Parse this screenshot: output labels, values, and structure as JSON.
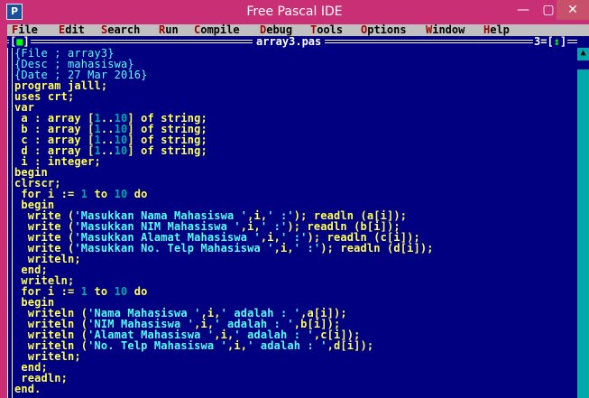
{
  "window": {
    "title": "Free Pascal IDE",
    "min": "—",
    "max": "▢",
    "close": "✕"
  },
  "menu": [
    {
      "hot": "F",
      "rest": "ile"
    },
    {
      "hot": "E",
      "rest": "dit"
    },
    {
      "hot": "S",
      "rest": "earch"
    },
    {
      "hot": "R",
      "rest": "un"
    },
    {
      "hot": "C",
      "rest": "ompile"
    },
    {
      "hot": "D",
      "rest": "ebug"
    },
    {
      "hot": "T",
      "rest": "ools"
    },
    {
      "hot": "O",
      "rest": "ptions"
    },
    {
      "hot": "W",
      "rest": "indow"
    },
    {
      "hot": "H",
      "rest": "elp"
    }
  ],
  "editor_window": {
    "close_box_left": "[",
    "close_box_mark": "■",
    "close_box_right": "]",
    "filename": "array3.pas",
    "number": "3",
    "zoom_left": "=[",
    "zoom_mark": "↕",
    "zoom_right": "]"
  },
  "code": [
    [
      [
        "cmt",
        "{File ; array3}"
      ]
    ],
    [
      [
        "cmt",
        "{Desc ; mahasiswa}"
      ]
    ],
    [
      [
        "cmt",
        "{Date ; 27 Mar 2016}"
      ]
    ],
    [
      [
        "t",
        "program jalll;"
      ]
    ],
    [
      [
        "t",
        "uses crt;"
      ]
    ],
    [
      [
        "t",
        "var"
      ]
    ],
    [
      [
        "t",
        " a : array ["
      ],
      [
        "num",
        "1"
      ],
      [
        "t",
        ".."
      ],
      [
        "num",
        "10"
      ],
      [
        "t",
        "] of string;"
      ]
    ],
    [
      [
        "t",
        " b : array ["
      ],
      [
        "num",
        "1"
      ],
      [
        "t",
        ".."
      ],
      [
        "num",
        "10"
      ],
      [
        "t",
        "] of string;"
      ]
    ],
    [
      [
        "t",
        " c : array ["
      ],
      [
        "num",
        "1"
      ],
      [
        "t",
        ".."
      ],
      [
        "num",
        "10"
      ],
      [
        "t",
        "] of string;"
      ]
    ],
    [
      [
        "t",
        " d : array ["
      ],
      [
        "num",
        "1"
      ],
      [
        "t",
        ".."
      ],
      [
        "num",
        "10"
      ],
      [
        "t",
        "] of string;"
      ]
    ],
    [
      [
        "t",
        " i : integer;"
      ]
    ],
    [
      [
        "t",
        "begin"
      ]
    ],
    [
      [
        "t",
        "clrscr;"
      ]
    ],
    [
      [
        "t",
        " for i := "
      ],
      [
        "num",
        "1"
      ],
      [
        "t",
        " to "
      ],
      [
        "num",
        "10"
      ],
      [
        "t",
        " do"
      ]
    ],
    [
      [
        "t",
        " begin"
      ]
    ],
    [
      [
        "t",
        "  write ("
      ],
      [
        "str",
        "'Masukkan Nama Mahasiswa '"
      ],
      [
        "t",
        ",i,"
      ],
      [
        "str",
        "' :'"
      ],
      [
        "t",
        "); readln (a[i]);"
      ]
    ],
    [
      [
        "t",
        "  write ("
      ],
      [
        "str",
        "'Masukkan NIM Mahasiswa '"
      ],
      [
        "t",
        ",i,"
      ],
      [
        "str",
        "' :'"
      ],
      [
        "t",
        "); readln (b[i]);"
      ]
    ],
    [
      [
        "t",
        "  write ("
      ],
      [
        "str",
        "'Masukkan Alamat Mahasiswa '"
      ],
      [
        "t",
        ",i,"
      ],
      [
        "str",
        "' :'"
      ],
      [
        "t",
        "); readln (c[i]);"
      ]
    ],
    [
      [
        "t",
        "  write ("
      ],
      [
        "str",
        "'Masukkan No. Telp Mahasiswa '"
      ],
      [
        "t",
        ",i,"
      ],
      [
        "str",
        "' :'"
      ],
      [
        "t",
        "); readln (d[i]);"
      ]
    ],
    [
      [
        "t",
        "  writeln;"
      ]
    ],
    [
      [
        "t",
        " end;"
      ]
    ],
    [
      [
        "t",
        " writeln;"
      ]
    ],
    [
      [
        "t",
        " for i := "
      ],
      [
        "num",
        "1"
      ],
      [
        "t",
        " to "
      ],
      [
        "num",
        "10"
      ],
      [
        "t",
        " do"
      ]
    ],
    [
      [
        "t",
        " begin"
      ]
    ],
    [
      [
        "t",
        "  writeln ("
      ],
      [
        "str",
        "'Nama Mahasiswa '"
      ],
      [
        "t",
        ",i,"
      ],
      [
        "str",
        "' adalah : '"
      ],
      [
        "t",
        ",a[i]);"
      ]
    ],
    [
      [
        "t",
        "  writeln ("
      ],
      [
        "str",
        "'NIM Mahasiswa '"
      ],
      [
        "t",
        ",i,"
      ],
      [
        "str",
        "' adalah : '"
      ],
      [
        "t",
        ",b[i]);"
      ]
    ],
    [
      [
        "t",
        "  writeln ("
      ],
      [
        "str",
        "'Alamat Mahasiswa '"
      ],
      [
        "t",
        ",i,"
      ],
      [
        "str",
        "' adalah : '"
      ],
      [
        "t",
        ",c[i]);"
      ]
    ],
    [
      [
        "t",
        "  writeln ("
      ],
      [
        "str",
        "'No. Telp Mahasiswa '"
      ],
      [
        "t",
        ",i,"
      ],
      [
        "str",
        "' adalah : '"
      ],
      [
        "t",
        ",d[i]);"
      ]
    ],
    [
      [
        "t",
        "  writeln;"
      ]
    ],
    [
      [
        "t",
        " end;"
      ]
    ],
    [
      [
        "t",
        " readln;"
      ]
    ],
    [
      [
        "t",
        "end."
      ]
    ]
  ],
  "scrollbar": {
    "up_arrow": "▲"
  },
  "colors": {
    "titlebar": "#c82f74",
    "desktop": "#000080",
    "menubar": "#c0c0c0",
    "hotkey": "#a00000",
    "code_text": "#ffff55",
    "comment": "#55ffff",
    "number": "#00aaaa",
    "scrollbar": "#00aaaa"
  }
}
